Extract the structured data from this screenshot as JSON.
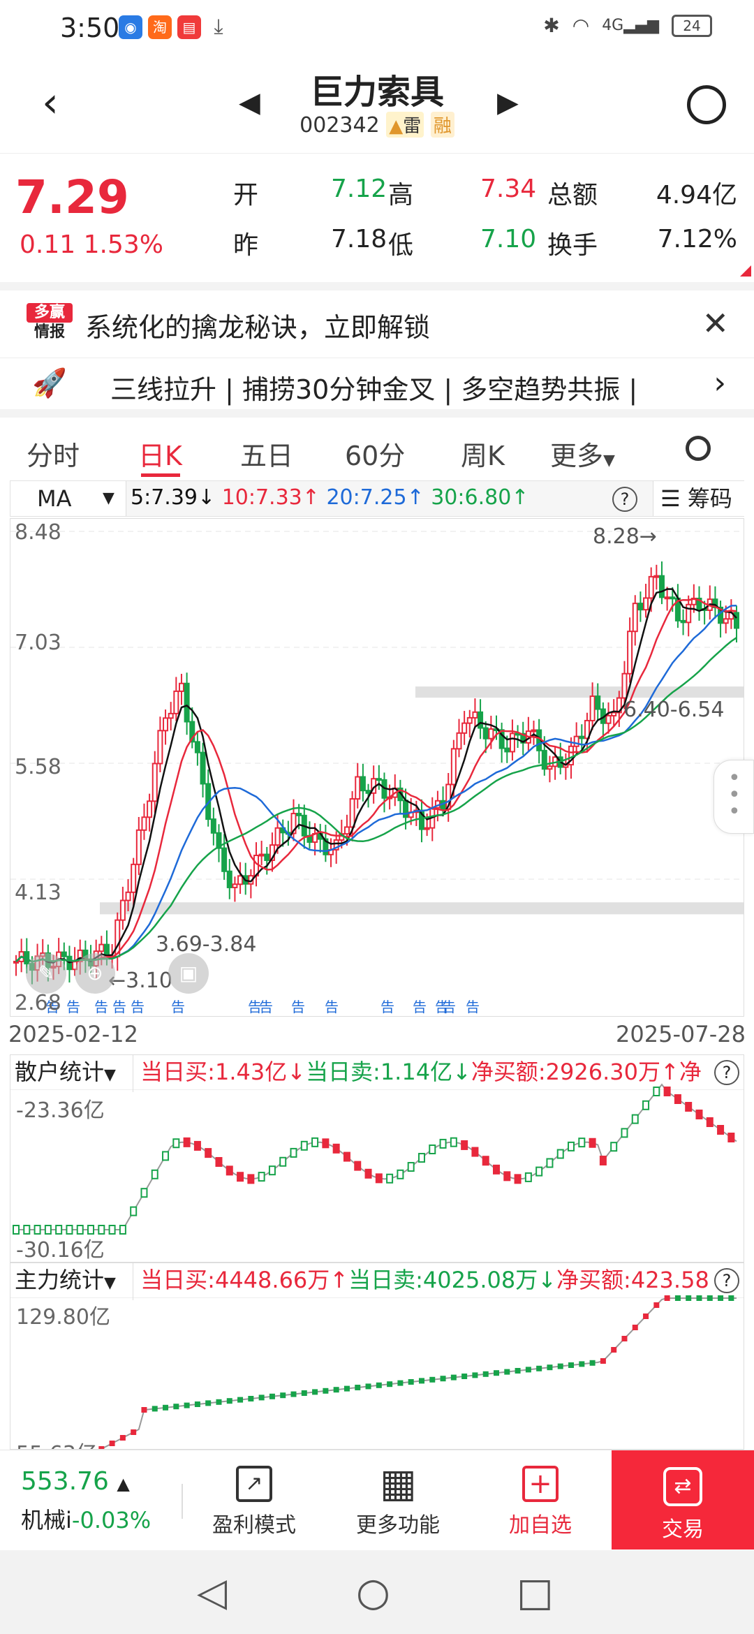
{
  "status": {
    "time": "3:50",
    "battery": "24",
    "net": "4G"
  },
  "header": {
    "title": "巨力索具",
    "code": "002342",
    "tag_lei": "雷",
    "tag_rong": "融"
  },
  "quote": {
    "price": "7.29",
    "change": "0.11",
    "change_pct": "1.53%",
    "open_label": "开",
    "open": "7.12",
    "high_label": "高",
    "high": "7.34",
    "amount_label": "总额",
    "amount": "4.94亿",
    "prev_label": "昨",
    "prev": "7.18",
    "low_label": "低",
    "low": "7.10",
    "turnover_label": "换手",
    "turnover": "7.12%"
  },
  "ad1": {
    "logo_top": "多赢",
    "logo_bottom": "情报",
    "text": "系统化的擒龙秘诀，立即解锁"
  },
  "ad2": {
    "text": "三线拉升 | 捕捞30分钟金叉 | 多空趋势共振 |"
  },
  "tabs": [
    "分时",
    "日K",
    "五日",
    "60分",
    "周K",
    "更多"
  ],
  "ma": {
    "select": "MA",
    "ma5": "5:7.39↓",
    "ma10": "10:7.33↑",
    "ma20": "20:7.25↑",
    "ma30": "30:6.80↑",
    "chip_label": "筹码"
  },
  "colors": {
    "up": "#e8283c",
    "down": "#16a34a",
    "ma5": "#111111",
    "ma10": "#e8283c",
    "ma20": "#1e6ad8",
    "ma30": "#16a34a"
  },
  "chart_data": {
    "type": "candlestick",
    "y_ticks": [
      "8.48",
      "7.03",
      "5.58",
      "4.13",
      "2.68"
    ],
    "ylim": [
      2.68,
      8.48
    ],
    "date_start": "2025-02-12",
    "date_end": "2025-07-28",
    "max_label": "8.28→",
    "min_label": "←3.10",
    "zone_upper": "6.40-6.54",
    "zone_lower": "3.69-3.84",
    "notice_tag": "告"
  },
  "retail": {
    "name": "散户统计",
    "buy": "当日买:1.43亿↓",
    "sell": "当日卖:1.14亿↓",
    "net": "净买额:2926.30万↑",
    "more": "净",
    "top": "-23.36亿",
    "bottom": "-30.16亿"
  },
  "main": {
    "name": "主力统计",
    "buy": "当日买:4448.66万↑",
    "sell": "当日卖:4025.08万↓",
    "net": "净买额:423.58",
    "top": "129.80亿",
    "bottom": "55.63亿"
  },
  "bottom": {
    "index_value": "553.76",
    "index_name": "机械i",
    "index_chg": "-0.03%",
    "btn1": "盈利模式",
    "btn2": "更多功能",
    "btn3": "加自选",
    "trade": "交易"
  }
}
